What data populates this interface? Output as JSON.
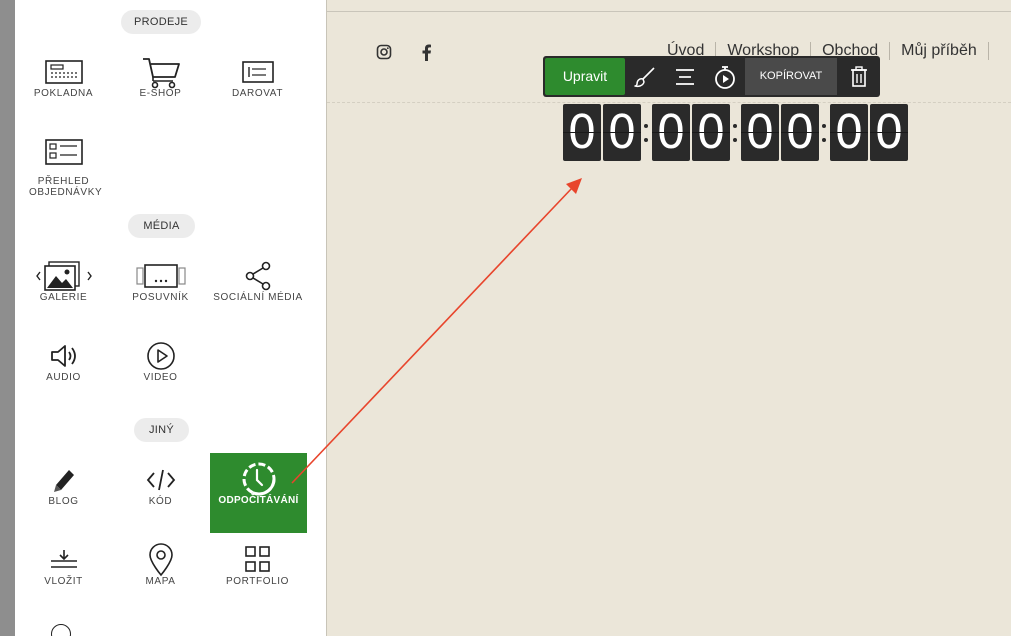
{
  "sidebar": {
    "sections": {
      "sales": "PRODEJE",
      "media": "MÉDIA",
      "other": "JINÝ"
    },
    "items": [
      {
        "id": "pokladna",
        "label": "POKLADNA",
        "icon": "cash-register-icon"
      },
      {
        "id": "eshop",
        "label": "E-SHOP",
        "icon": "shopping-cart-icon"
      },
      {
        "id": "darovat",
        "label": "DAROVAT",
        "icon": "donate-card-icon"
      },
      {
        "id": "prehled",
        "label": "PŘEHLED OBJEDNÁVKY",
        "icon": "order-summary-icon"
      },
      {
        "id": "galerie",
        "label": "GALERIE",
        "icon": "gallery-icon"
      },
      {
        "id": "posuvnik",
        "label": "POSUVNÍK",
        "icon": "slider-icon"
      },
      {
        "id": "socialni",
        "label": "SOCIÁLNÍ MÉDIA",
        "icon": "share-icon"
      },
      {
        "id": "audio",
        "label": "AUDIO",
        "icon": "speaker-icon"
      },
      {
        "id": "video",
        "label": "VIDEO",
        "icon": "play-icon"
      },
      {
        "id": "blog",
        "label": "BLOG",
        "icon": "pencil-icon"
      },
      {
        "id": "kod",
        "label": "KÓD",
        "icon": "code-icon"
      },
      {
        "id": "odpocitavani",
        "label": "ODPOČÍTÁVÁNÍ",
        "icon": "countdown-timer-icon",
        "active": true
      },
      {
        "id": "vlozit",
        "label": "VLOŽIT",
        "icon": "embed-icon"
      },
      {
        "id": "mapa",
        "label": "MAPA",
        "icon": "map-pin-icon"
      },
      {
        "id": "portfolio",
        "label": "PORTFOLIO",
        "icon": "portfolio-grid-icon"
      }
    ]
  },
  "site": {
    "social": [
      "instagram-icon",
      "facebook-icon"
    ],
    "nav": [
      "Úvod",
      "Workshop",
      "Obchod",
      "Můj příběh"
    ]
  },
  "toolbar": {
    "edit_label": "Upravit",
    "copy_label": "KOPÍROVAT",
    "icons": [
      "brush-icon",
      "align-center-icon",
      "timer-icon",
      "trash-icon"
    ]
  },
  "countdown": {
    "digits": [
      "0",
      "0",
      "0",
      "0",
      "0",
      "0",
      "0",
      "0"
    ]
  },
  "colors": {
    "accent_green": "#2e8b2e",
    "toolbar_dark": "#2a2a2a",
    "canvas_bg": "#ebe6d9",
    "arrow_red": "#e8452c"
  }
}
